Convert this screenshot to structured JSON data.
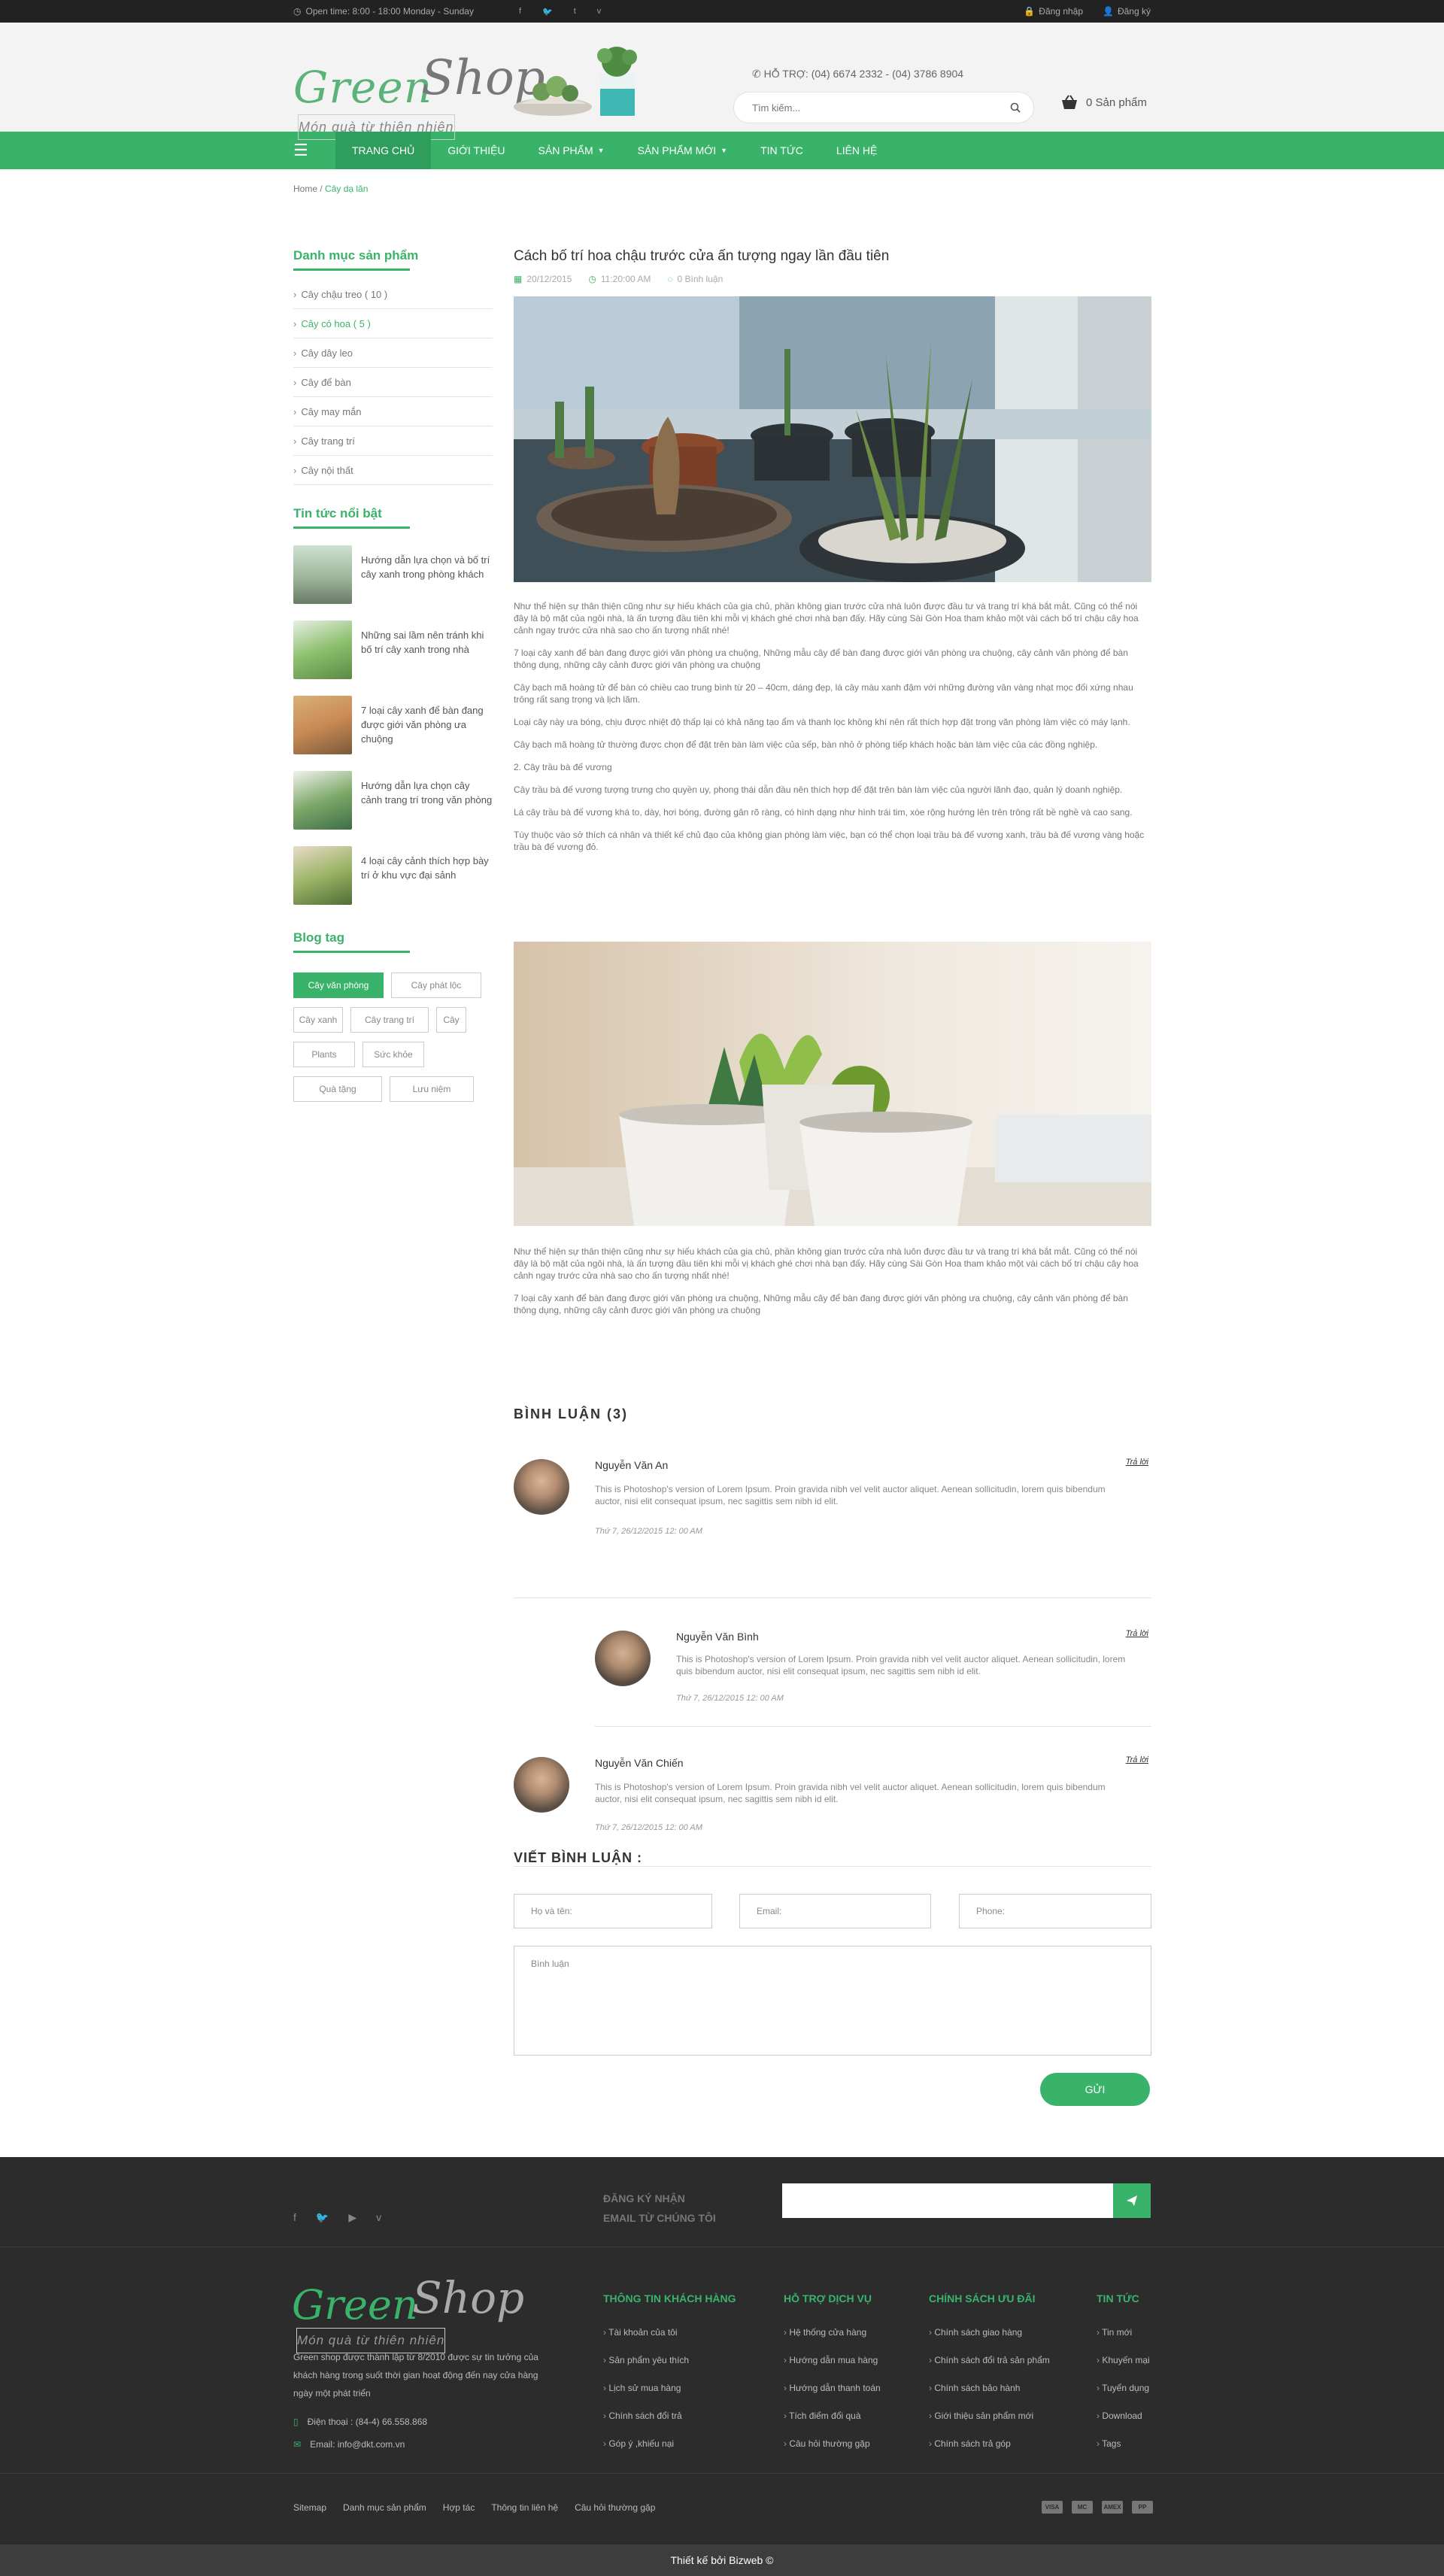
{
  "topbar": {
    "open_time": "Open time: 8:00 - 18:00   Monday - Sunday",
    "socials": [
      "f",
      "🐦",
      "t",
      "v"
    ],
    "login": "Đăng nhập",
    "register": "Đăng ký"
  },
  "header": {
    "logo_green": "Green",
    "logo_shop": "Shop",
    "logo_tagline": "Món quà từ thiên nhiên",
    "hotline": "HỖ TRỢ:  (04) 6674 2332 - (04) 3786 8904",
    "search_placeholder": "Tìm kiếm...",
    "cart": "0 Sản phẩm"
  },
  "nav": {
    "items": [
      "Trang chủ",
      "Giới thiệu",
      "Sản phẩm",
      "Sản phẩm mới",
      "Tin tức",
      "Liên hệ"
    ]
  },
  "breadcrumb": {
    "home": "Home",
    "sep": " / ",
    "current": "Cây dạ lăn"
  },
  "sidebar": {
    "categories_title": "Danh mục sản phẩm",
    "categories": [
      "Cây chậu treo ( 10 )",
      "Cây có hoa ( 5 )",
      "Cây dây leo",
      "Cây để bàn",
      "Cây may mắn",
      "Cây trang trí",
      "Cây nội thất"
    ],
    "news_title": "Tin tức nổi bật",
    "news": [
      "Hướng dẫn lựa chọn và bố trí cây xanh trong phòng khách",
      "Những sai lầm nên tránh khi bố trí cây xanh trong nhà",
      "7 loại cây xanh để bàn đang được giới văn phòng ưa chuộng",
      "Hướng dẫn lựa chọn cây cảnh trang trí trong văn phòng",
      "4 loại cây cảnh thích hợp bày trí ở khu vực đại sảnh"
    ],
    "tags_title": "Blog tag",
    "tags": [
      "Cây văn phòng",
      "Cây phát lộc",
      "Cây xanh",
      "Cây trang trí",
      "Cây",
      "Plants",
      "Sức khỏe",
      "Quà tặng",
      "Lưu niệm"
    ]
  },
  "article": {
    "title": "Cách bố trí hoa chậu trước cửa ấn tượng ngay lần đầu tiên",
    "date": "20/12/2015",
    "time": "11:20:00 AM",
    "comments_count": "0 Bình luận",
    "paragraphs": [
      "Như thể hiện sự thân thiện cũng như sự hiếu khách của gia chủ, phần không gian trước cửa nhà luôn được đầu tư và trang trí khá bắt mắt. Cũng có thể nói đây là bộ mặt của ngôi nhà, là ấn tượng đầu tiên khi mỗi vị khách ghé chơi nhà bạn đấy. Hãy cùng Sài Gòn Hoa tham khảo một vài cách bố trí chậu cây hoa cảnh ngay trước cửa nhà sao cho ấn tượng nhất nhé!",
      "7 loại cây xanh để bàn đang được giới văn phòng ưa chuộng, Những mẫu cây để bàn đang được giới văn phòng ưa chuộng, cây cảnh văn phòng để bàn thông dụng, những cây cảnh được giới văn phòng ưa chuộng",
      " Cây bạch mã hoàng tử để bàn có chiều cao trung bình từ 20 – 40cm, dáng đẹp, lá cây màu xanh đậm với những đường vân vàng nhạt mọc đối xứng nhau trông rất sang trọng và lịch lãm.",
      " Loại cây này ưa bóng, chịu được nhiệt độ thấp lại có khả năng tạo ẩm và thanh lọc không khí nên rất thích hợp đặt trong văn phòng làm việc có máy lạnh.",
      " Cây bạch mã hoàng tử thường được chọn để đặt trên bàn làm việc của sếp, bàn nhỏ ở phòng tiếp khách hoặc bàn làm việc của các đồng nghiệp.",
      "2. Cây trầu bà đế vương",
      "Cây trầu bà đế vương tượng trưng cho quyền uy, phong thái dẫn đầu nên thích hợp để đặt trên bàn làm việc của người lãnh đạo, quản lý doanh nghiệp.",
      " Lá cây trầu bà đế vương khá to, dày, hơi bóng, đường gân rõ ràng, có hình dạng như hình trái tim, xòe rộng hướng lên trên trông rất bề nghề và cao sang.",
      "Tùy thuộc vào sở thích cá nhân và thiết kế chủ đạo của không gian phòng làm việc, bạn có thể chọn loại trầu bà đế vương xanh, trầu bà đế vương vàng hoặc trầu bà đế vương đỏ."
    ],
    "paragraphs2": [
      "Như thể hiện sự thân thiện cũng như sự hiếu khách của gia chủ, phần không gian trước cửa nhà luôn được đầu tư và trang trí khá bắt mắt. Cũng có thể nói đây là bộ mặt của ngôi nhà, là ấn tượng đầu tiên khi mỗi vị khách ghé chơi nhà bạn đấy. Hãy cùng Sài Gòn Hoa tham khảo một vài cách bố trí chậu cây hoa cảnh ngay trước cửa nhà sao cho ấn tượng nhất nhé!",
      "7 loại cây xanh để bàn đang được giới văn phòng ưa chuộng, Những mẫu cây để bàn đang được giới văn phòng ưa chuộng, cây cảnh văn phòng để bàn thông dụng, những cây cảnh được giới văn phòng ưa chuộng"
    ]
  },
  "comments": {
    "title": "BÌNH  LUẬN (3)",
    "reply": "Trả lời",
    "items": [
      {
        "name": "Nguyễn Văn An",
        "text": "This is Photoshop's version  of Lorem Ipsum. Proin gravida nibh vel velit auctor aliquet. Aenean sollicitudin, lorem quis bibendum auctor, nisi elit consequat ipsum, nec sagittis sem nibh id elit.",
        "date": "Thứ 7, 26/12/2015 12: 00 AM"
      },
      {
        "name": "Nguyễn Văn Bình",
        "text": "This is Photoshop's version  of Lorem Ipsum. Proin gravida nibh vel velit auctor aliquet. Aenean sollicitudin, lorem quis bibendum auctor, nisi elit consequat ipsum, nec sagittis sem nibh id elit.",
        "date": "Thứ 7, 26/12/2015 12: 00 AM"
      },
      {
        "name": "Nguyễn Văn Chiến",
        "text": "This is Photoshop's version  of Lorem Ipsum. Proin gravida nibh vel velit auctor aliquet. Aenean sollicitudin, lorem quis bibendum auctor, nisi elit consequat ipsum, nec sagittis sem nibh id elit.",
        "date": "Thứ 7, 26/12/2015 12: 00 AM"
      }
    ]
  },
  "form": {
    "title": "VIẾT BÌNH LUẬN :",
    "name": "Họ và tên:",
    "email": "Email:",
    "phone": "Phone:",
    "comment": "Bình luận",
    "send": "GỬI"
  },
  "footer": {
    "subscribe_line1": "ĐĂNG KÝ NHẬN",
    "subscribe_line2": "EMAIL TỪ CHÚNG TÔI",
    "logo_green": "Green",
    "logo_shop": "Shop",
    "logo_tagline": "Món quà từ thiên nhiên",
    "desc": "Green shop được thành lập từ 8/2010 được sự tin tưởng của khách hàng trong suốt thời gian hoạt động đến nay cửa hàng ngày một phát triển",
    "phone": "Điện thoại : (84-4) 66.558.868",
    "email": "Email: info@dkt.com.vn",
    "columns": [
      {
        "title": "THÔNG TIN KHÁCH HÀNG",
        "items": [
          "Tài khoản của tôi",
          "Sản phẩm yêu thích",
          "Lịch sử mua hàng",
          "Chính sách đổi trả",
          "Góp ý ,khiếu nại"
        ]
      },
      {
        "title": "HỖ TRỢ DỊCH VỤ",
        "items": [
          "Hệ thống cửa hàng",
          "Hướng dẫn mua hàng",
          "Hướng dẫn thanh toán",
          "Tích điểm đổi quà",
          "Câu hỏi thường gặp"
        ]
      },
      {
        "title": "CHÍNH SÁCH ƯU ĐÃI",
        "items": [
          "Chính sách giao hàng",
          "Chính sách đổi trả sản phẩm",
          "Chính sách bảo hành",
          "Giới thiệu sản phẩm mới",
          "Chính sách trả góp"
        ]
      },
      {
        "title": "TIN TỨC",
        "items": [
          "Tin mới",
          "Khuyến mại",
          "Tuyển dụng",
          "Download",
          "Tags"
        ]
      }
    ],
    "links": [
      "Sitemap",
      "Danh mục sản phẩm",
      "Hợp tác",
      "Thông tin liên hệ",
      "Câu hỏi thường gặp"
    ],
    "payments": [
      "VISA",
      "MC",
      "AMEX",
      "PP"
    ],
    "copyright": "Thiết kế  bởi Bizweb ©"
  },
  "colors": {
    "accent": "#3ab36a",
    "topbar": "#222222",
    "footer": "#2c2c2c"
  }
}
